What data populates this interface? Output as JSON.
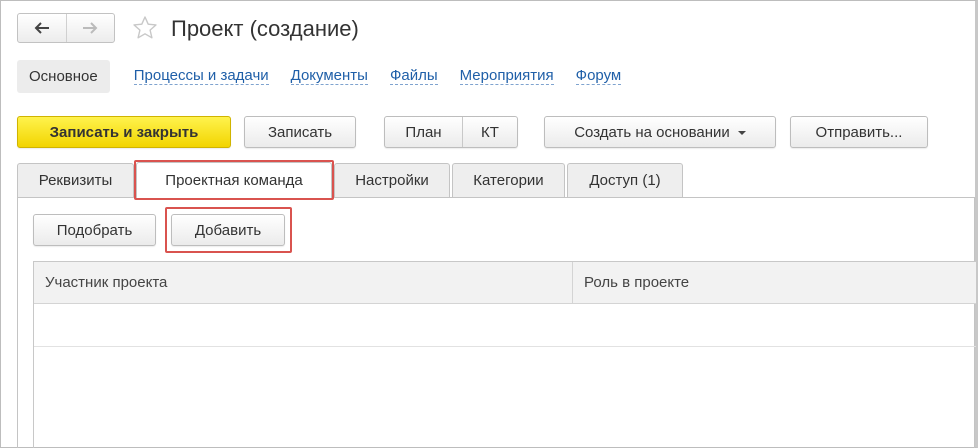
{
  "window": {
    "title": "Проект (создание)",
    "icons": {
      "back": "arrow-left-icon",
      "forward": "arrow-right-icon",
      "favorite": "star-icon"
    }
  },
  "sections": [
    {
      "label": "Основное",
      "active": true
    },
    {
      "label": "Процессы и задачи",
      "active": false
    },
    {
      "label": "Документы",
      "active": false
    },
    {
      "label": "Файлы",
      "active": false
    },
    {
      "label": "Мероприятия",
      "active": false
    },
    {
      "label": "Форум",
      "active": false
    }
  ],
  "toolbar": {
    "save_close": "Записать и закрыть",
    "save": "Записать",
    "plan": "План",
    "kt": "КТ",
    "create_based": "Создать на основании",
    "send": "Отправить..."
  },
  "tabs": [
    {
      "label": "Реквизиты",
      "active": false
    },
    {
      "label": "Проектная команда",
      "active": true
    },
    {
      "label": "Настройки",
      "active": false
    },
    {
      "label": "Категории",
      "active": false
    },
    {
      "label": "Доступ (1)",
      "active": false
    }
  ],
  "team": {
    "select_button": "Подобрать",
    "add_button": "Добавить",
    "columns": [
      "Участник проекта",
      "Роль в проекте"
    ],
    "rows": []
  },
  "colors": {
    "primary_button": "#f2d400",
    "link": "#1f5fa8",
    "highlight": "#d9534f"
  }
}
